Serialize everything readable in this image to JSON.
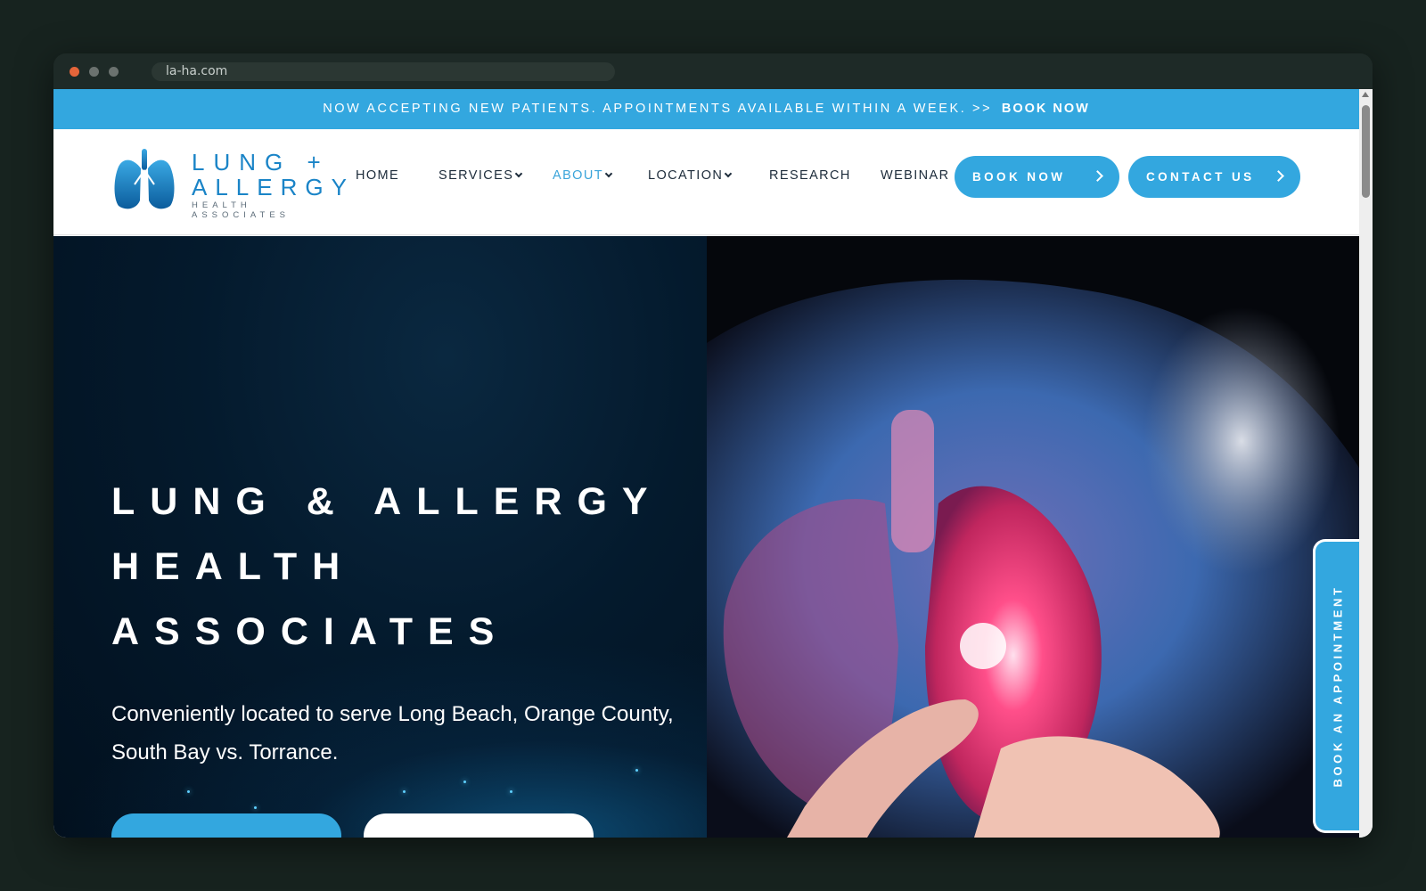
{
  "browser": {
    "url": "la-ha.com"
  },
  "colors": {
    "traffic_close": "#e5653a",
    "traffic_other": "#6b726f",
    "accent": "#33a7df",
    "nav_text": "#1c2b3a",
    "hero_bg": "#041a2d"
  },
  "announcement": {
    "text": "NOW ACCEPTING NEW PATIENTS. APPOINTMENTS AVAILABLE WITHIN A WEEK. >>",
    "link": "BOOK NOW"
  },
  "logo": {
    "line1": "LUNG +",
    "line2": "ALLERGY",
    "line3": "HEALTH ASSOCIATES",
    "icon": "lungs-icon"
  },
  "nav": {
    "items": [
      {
        "label": "HOME",
        "has_dropdown": false,
        "active": false
      },
      {
        "label": "SERVICES",
        "has_dropdown": true,
        "active": false
      },
      {
        "label": "ABOUT",
        "has_dropdown": true,
        "active": true
      },
      {
        "label": "LOCATION",
        "has_dropdown": true,
        "active": false
      },
      {
        "label": "RESEARCH",
        "has_dropdown": false,
        "active": false
      },
      {
        "label": "WEBINAR",
        "has_dropdown": false,
        "active": false
      }
    ],
    "book_now": "BOOK NOW",
    "contact_us": "CONTACT US"
  },
  "hero": {
    "title_line1": "LUNG & ALLERGY",
    "title_line2": "HEALTH",
    "title_line3": "ASSOCIATES",
    "subtitle": "Conveniently located to serve Long Beach, Orange County, South Bay vs. Torrance."
  },
  "side_tab": {
    "label": "BOOK AN APPOINTMENT"
  }
}
